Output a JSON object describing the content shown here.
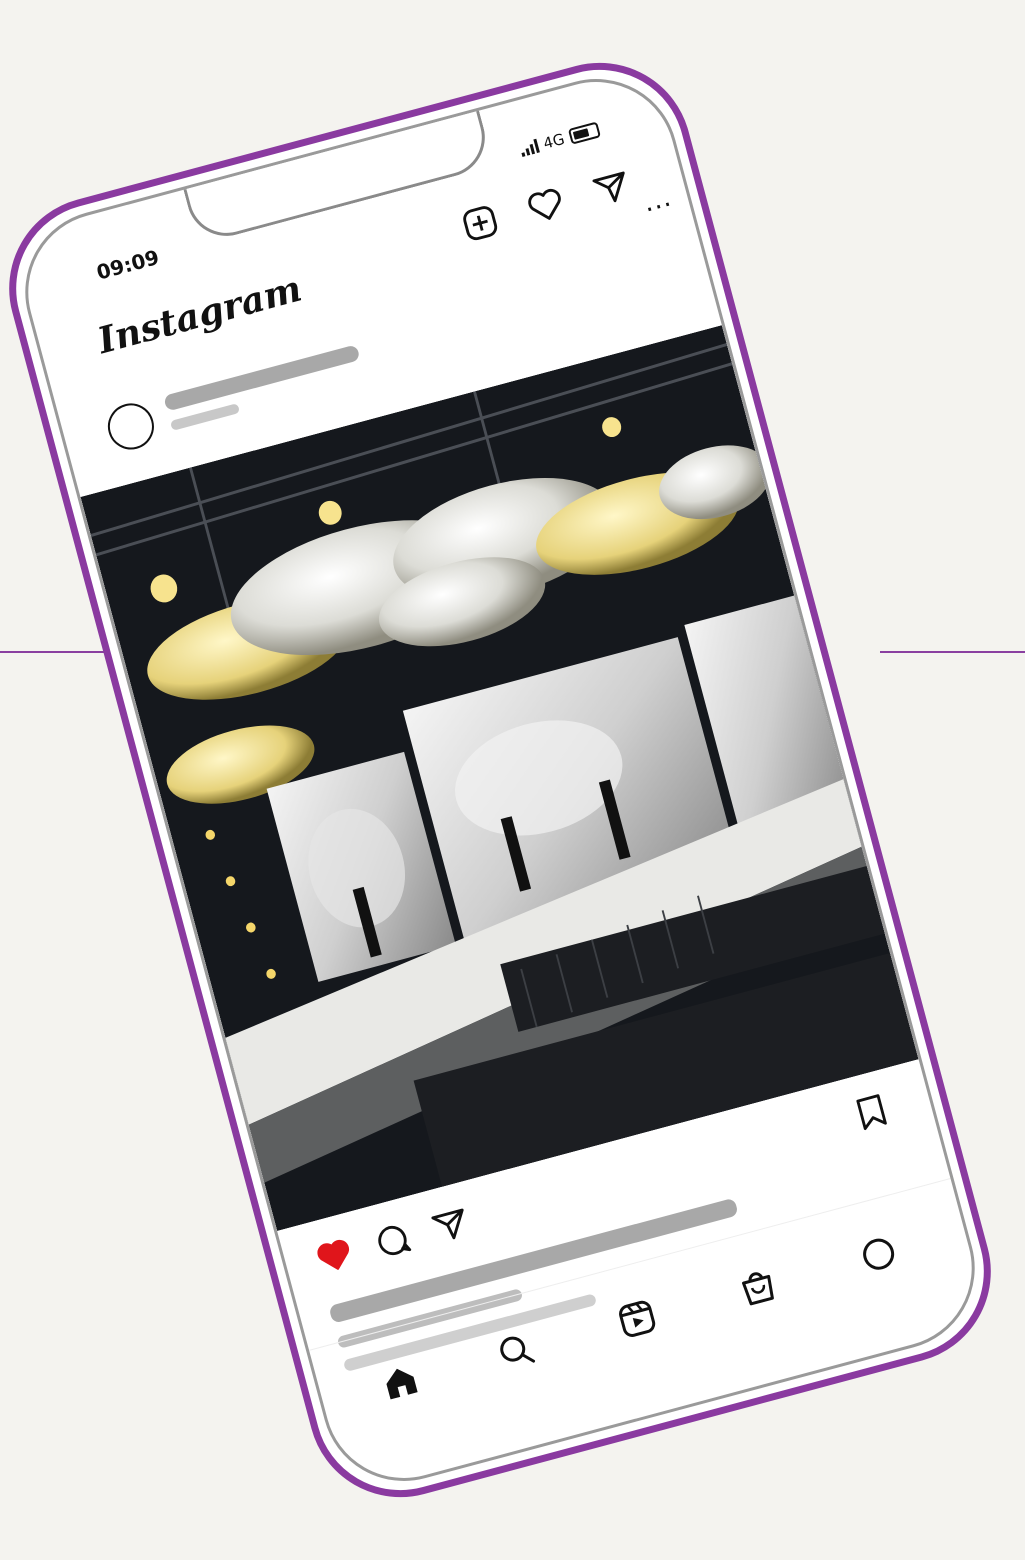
{
  "status": {
    "time": "09:09",
    "network": "4G"
  },
  "app": {
    "name": "Instagram"
  },
  "header": {
    "icons": [
      "new-post-icon",
      "heart-icon",
      "direct-message-icon"
    ]
  },
  "post": {
    "menu": "...",
    "liked": true,
    "actions": [
      "like-icon",
      "comment-icon",
      "share-icon",
      "save-icon"
    ]
  },
  "tabbar": {
    "items": [
      "home-icon",
      "search-icon",
      "reels-icon",
      "shop-icon",
      "profile-icon"
    ]
  },
  "colors": {
    "accent": "#8a3aa0",
    "like": "#e0151b",
    "background": "#f4f3ef"
  }
}
